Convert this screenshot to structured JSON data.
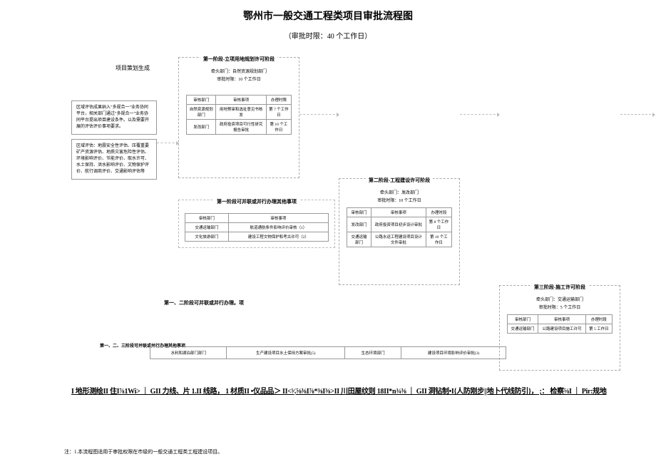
{
  "title": "鄂州市一般交通工程类项目审批流程图",
  "subtitle": "（审批时限：40 个工作日）",
  "col0": {
    "label": "项目策划生成",
    "box1": "区域评估成果纳入\"多规合一\"业务协同平台，相关部门通过\"多规合一\"业务协同平台提出项目建设条件。以及需要开展的评估评价事项要求。",
    "box2": "区域评估：地震安全性评估、压覆重要矿产资源评估、地质灾害危险性评估、环境影响评价、节能评价、取水许可、水土保持、洪水影响评价、文物保护评价、航行调商评价、交通影响评估等"
  },
  "stage1": {
    "title": "第一阶段-立项用地规划许可阶段",
    "lead": "牵头部门：自然资源规划部门",
    "time": "审批时限：10 个工作日",
    "th": [
      "审核部门",
      "审核事项",
      "办理时限"
    ],
    "rows": [
      [
        "自然资源规划部门",
        "用地预审和选址意见书核发",
        "第 7 个工作日"
      ],
      [
        "发改部门",
        "政府投资项目可行性研究报告审批",
        "第 10 个工作日"
      ]
    ]
  },
  "stage1_sub": {
    "title": "第一阶段可并联或并行办理其他事项",
    "th": [
      "审核部门",
      "审核事项"
    ],
    "rows": [
      [
        "交通运输部门",
        "航道通航条件影响评价审核（1）"
      ],
      [
        "文化旅游部门",
        "建设工程文物保护和考古许可（2）"
      ]
    ]
  },
  "stage2": {
    "title": "第二阶段-工程建设许可阶段",
    "lead": "牵头部门：发改部门",
    "time": "审批时限：10 个工作日",
    "th": [
      "审核部门",
      "审核事项",
      "办理时段"
    ],
    "rows": [
      [
        "发改部门",
        "政府投资项目初步设计审批",
        "第 8 个工作日"
      ],
      [
        "交通运输部门",
        "公路水运工程建设项目设计文件审批",
        "第 10 个工作日"
      ]
    ]
  },
  "stage3": {
    "title": "第三阶段-施工许可阶段",
    "lead": "牵头部门：交通运输部门",
    "time": "审批时限：5 个工作日",
    "th": [
      "审核部门",
      "审核事项",
      "办理时段"
    ],
    "rows": [
      [
        "交通运输部门",
        "公路建设项目施工许可",
        "第 5 工作日"
      ]
    ]
  },
  "note1": "第一、二阶段可并联或并行办理。项",
  "note2": "第一、二、三阶段可并联或并行办理其他事项",
  "bottom_table": {
    "cells": [
      "水利和湖泊部门部门",
      "生产建设项目水土保持方案审批(5)",
      "生态环境部门",
      "建设项目环境影响评价审批(3)"
    ]
  },
  "garbled": "I 地形测绘II 住I⅞1Wi> ｜ GII 力线、片 1.II 线路， 1 材质II •仪品品＞ II<⁵⁄₇⅝⅜I⅞*⅜I⅜>II 川田屋纹则 18II*n¾⅜ ｜ GII 洞钻制•I{人防刚步||地卜代线防引}， ;： 检察⅝I ｜ Pir:规地",
  "footnote": "注：1.本流程图适用于审批权限在市级的一般交通工程类工程建设项目。"
}
